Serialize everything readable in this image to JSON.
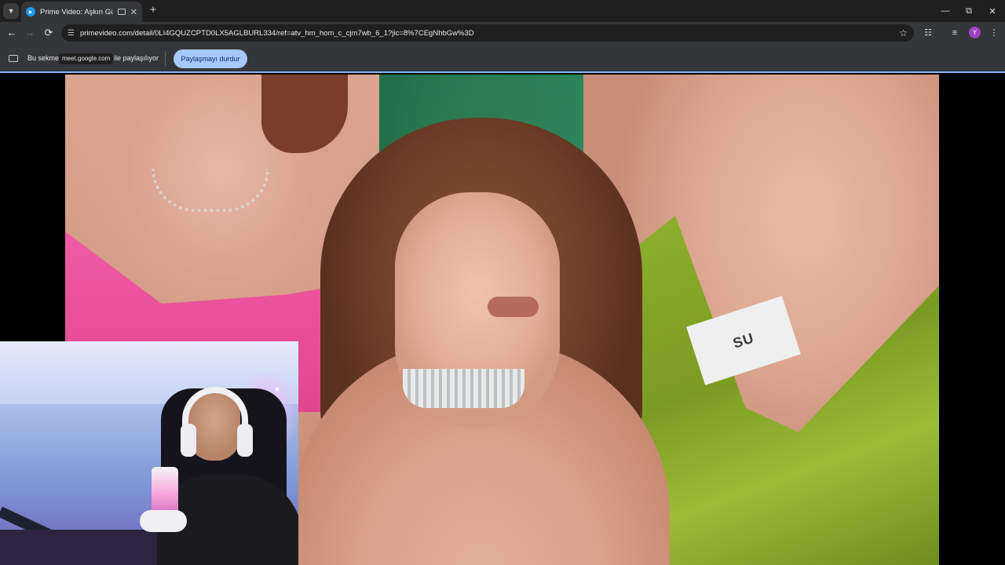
{
  "browser": {
    "tab": {
      "title": "Prime Video: Aşkın Gücü",
      "favicon": "prime-video-icon"
    },
    "new_tab_icon": "+",
    "window_controls": [
      "minimize",
      "restore",
      "close"
    ],
    "omnibox": {
      "url": "primevideo.com/detail/0LI4GQUZCPTD0LX5AGLBURL334/ref=atv_hm_hom_c_cjm7wb_6_1?jic=8%7CEgNhbGw%3D"
    },
    "profile_initial": "Y",
    "profile_color": "#a142c4"
  },
  "share_bar": {
    "text_before": "Bu sekme",
    "site_chip": "meet.google.com",
    "text_after": "ile paylaşılıyor",
    "stop_button": "Paylaşmayı durdur",
    "accent": "#a8c7fa"
  },
  "video": {
    "name_tag": "SU"
  }
}
